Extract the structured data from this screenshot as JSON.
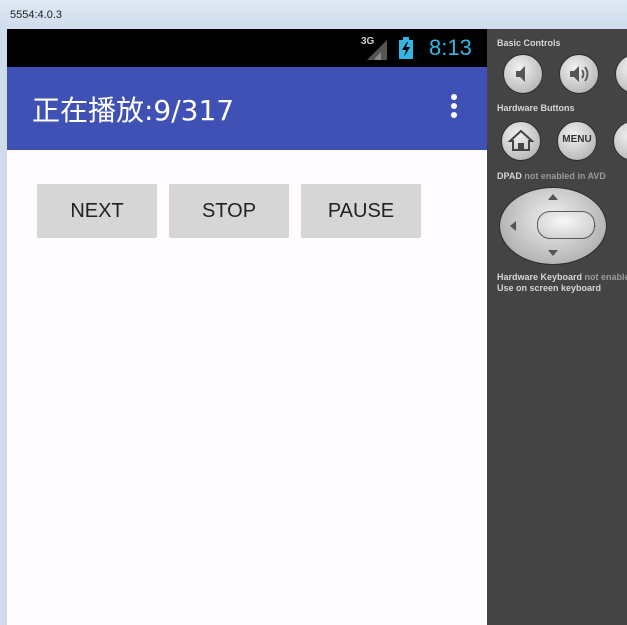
{
  "window": {
    "title": "5554:4.0.3"
  },
  "status_bar": {
    "network": "3G",
    "time": "8:13",
    "signal_icon": "signal-icon",
    "battery_icon": "battery-charging-icon"
  },
  "app_bar": {
    "title": "正在播放:9/317",
    "menu_icon": "overflow-menu-icon"
  },
  "buttons": {
    "next": "NEXT",
    "stop": "STOP",
    "pause": "PAUSE"
  },
  "controls": {
    "basic_controls": "Basic Controls",
    "hardware_buttons": "Hardware Buttons",
    "menu_label": "MENU",
    "dpad_label": "DPAD",
    "dpad_note": "not enabled in AVD",
    "keyboard_label": "Hardware Keyboard",
    "keyboard_note": "not enabled",
    "keyboard_hint": "Use on screen keyboard"
  },
  "colors": {
    "app_bar": "#3f51b5",
    "clock": "#33b5e5",
    "button": "#d6d6d6",
    "panel": "#444444"
  }
}
